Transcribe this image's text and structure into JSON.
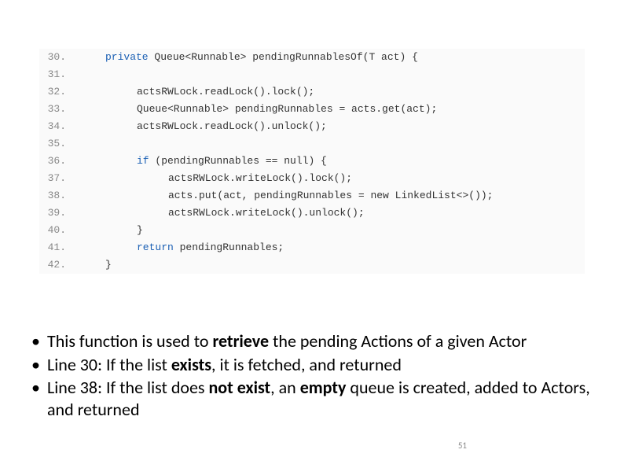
{
  "code": {
    "lines": [
      {
        "n": "30.",
        "ind": 1,
        "kw": "private",
        "rest": " Queue<Runnable> pendingRunnablesOf(T act) {"
      },
      {
        "n": "31.",
        "ind": 1,
        "kw": "",
        "rest": ""
      },
      {
        "n": "32.",
        "ind": 2,
        "kw": "",
        "rest": "actsRWLock.readLock().lock();"
      },
      {
        "n": "33.",
        "ind": 2,
        "kw": "",
        "rest": "Queue<Runnable> pendingRunnables = acts.get(act);"
      },
      {
        "n": "34.",
        "ind": 2,
        "kw": "",
        "rest": "actsRWLock.readLock().unlock();"
      },
      {
        "n": "35.",
        "ind": 1,
        "kw": "",
        "rest": ""
      },
      {
        "n": "36.",
        "ind": 2,
        "kw": "if",
        "rest": " (pendingRunnables == null) {"
      },
      {
        "n": "37.",
        "ind": 3,
        "kw": "",
        "rest": "actsRWLock.writeLock().lock();"
      },
      {
        "n": "38.",
        "ind": 3,
        "kw": "",
        "rest": "acts.put(act, pendingRunnables = new LinkedList<>());"
      },
      {
        "n": "39.",
        "ind": 3,
        "kw": "",
        "rest": "actsRWLock.writeLock().unlock();"
      },
      {
        "n": "40.",
        "ind": 2,
        "kw": "",
        "rest": "}"
      },
      {
        "n": "41.",
        "ind": 2,
        "kw": "return",
        "rest": " pendingRunnables;"
      },
      {
        "n": "42.",
        "ind": 1,
        "kw": "",
        "rest": "}"
      }
    ]
  },
  "bullets": {
    "items": [
      {
        "pre": "This function is used to ",
        "b1": "retrieve",
        "post": " the pending Actions of a given Actor"
      },
      {
        "pre": "Line 30: If the list ",
        "b1": "exists",
        "post": ", it is fetched, and returned"
      },
      {
        "pre": "Line 38: If the list does ",
        "b1": "not exist",
        "mid": ", an ",
        "b2": "empty",
        "post": " queue is created, added to Actors, and returned"
      }
    ]
  },
  "page_number": "51"
}
